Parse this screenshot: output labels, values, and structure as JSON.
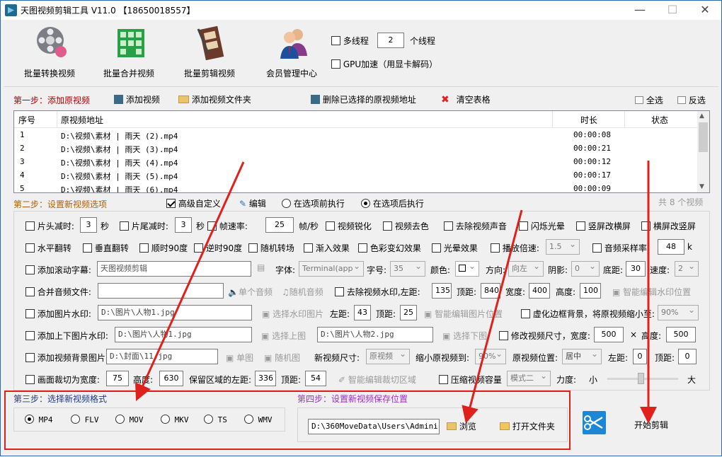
{
  "window": {
    "title": "天图视频剪辑工具 V11.0 【18650018557】"
  },
  "toolbar": {
    "batch_convert": "批量转换视频",
    "batch_merge": "批量合并视频",
    "batch_edit": "批量剪辑视频",
    "member": "会员管理中心",
    "multithread_label": "多线程",
    "thread_count": "2",
    "thread_unit": "个线程",
    "gpu_label": "GPU加速（用显卡解码）"
  },
  "step1": {
    "title": "第一步：添加原视频",
    "add_video": "添加视频",
    "add_folder": "添加视频文件夹",
    "delete_selected": "删除已选择的原视频地址",
    "clear_table": "清空表格",
    "select_all": "全选",
    "invert": "反选"
  },
  "table": {
    "headers": [
      "序号",
      "原视频地址",
      "时长",
      "状态"
    ],
    "rows": [
      {
        "no": "1",
        "path": "D:\\视频\\素材 | 雨天 (2).mp4",
        "duration": "00:00:08"
      },
      {
        "no": "2",
        "path": "D:\\视频\\素材 | 雨天 (3).mp4",
        "duration": "00:00:21"
      },
      {
        "no": "3",
        "path": "D:\\视频\\素材 | 雨天 (4).mp4",
        "duration": "00:00:12"
      },
      {
        "no": "4",
        "path": "D:\\视频\\素材 | 雨天 (5).mp4",
        "duration": "00:00:17"
      },
      {
        "no": "5",
        "path": "D:\\视频\\素材 | 雨天 (6).mp4",
        "duration": "00:00:09"
      }
    ],
    "count": "共 8 个视频"
  },
  "step2": {
    "title": "第二步：设置新视频选项",
    "advanced": "高级自定义",
    "edit": "编辑",
    "before": "在选项前执行",
    "after": "在选项后执行",
    "r1": {
      "head_cut": "片头减时:",
      "head_val": "3",
      "sec1": "秒",
      "tail_cut": "片尾减时:",
      "tail_val": "3",
      "sec2": "秒",
      "fps_cut": "帧速率:",
      "fps_val": "25",
      "fps_unit": "帧/秒",
      "sharpen": "视频锐化",
      "decolor": "视频去色",
      "remove_audio": "去除视频声音",
      "flash": "闪烁光晕",
      "v2h": "竖屏改横屏",
      "h2v": "横屏改竖屏"
    },
    "r2": {
      "hflip": "水平翻转",
      "vflip": "垂直翻转",
      "rot90cw": "顺时90度",
      "rot90ccw": "逆时90度",
      "random_trans": "随机转场",
      "fadein": "渐入效果",
      "color_fx": "色彩变幻效果",
      "halo": "光晕效果",
      "speed": "播放倍速:",
      "speed_val": "1.5",
      "sample": "音频采样率",
      "sample_val": "48",
      "sample_unit": "k"
    },
    "r3": {
      "scroll_sub": "添加滚动字幕:",
      "sub_text": "天图视频剪辑",
      "font_label": "字体:",
      "font_val": "Terminal(app",
      "size_label": "字号:",
      "size_val": "35",
      "color_label": "颜色:",
      "dir_label": "方向:",
      "dir_val": "向左",
      "shadow_label": "阴影:",
      "shadow_val": "0",
      "bottom_label": "底距:",
      "bottom_val": "30",
      "speed_label": "速度:",
      "speed_val": "2"
    },
    "r4": {
      "merge_audio": "合并音频文件:",
      "single_audio": "单个音频",
      "random_audio": "随机音频",
      "remove_wm": "去除视频水印,左距:",
      "left_val": "135",
      "top_label": "顶距:",
      "top_val": "840",
      "w_label": "宽度:",
      "w_val": "400",
      "h_label": "高度:",
      "h_val": "100",
      "smart_wm": "智能编辑水印位置"
    },
    "r5": {
      "img_wm": "添加图片水印:",
      "img_path": "D:\\图片\\人物1.jpg",
      "choose_wm": "选择水印图片",
      "left_label": "左距:",
      "left_val": "43",
      "top_label": "顶距:",
      "top_val": "25",
      "smart_img": "智能编辑图片位置",
      "blur_bg": "虚化边框背景，将原视频缩小至:",
      "blur_val": "90%"
    },
    "r6": {
      "tb_img": "添加上下图片水印:",
      "top_img": "D:\\图片\\人物1.jpg",
      "choose_top": "选择上图",
      "bottom_img": "D:\\图片\\人物2.jpg",
      "choose_bottom": "选择下图",
      "resize": "修改视频尺寸，宽度:",
      "w_val": "500",
      "x": "×",
      "h_label": "高度:",
      "h_val": "500"
    },
    "r7": {
      "bg_img": "添加视频背景图片:",
      "bg_path": "D:\\封面\\11.jpg",
      "single_img": "单图",
      "random_img": "随机图",
      "new_size": "新视频尺寸:",
      "size_val": "原视频",
      "shrink": "缩小原视频到:",
      "shrink_val": "90%",
      "pos_label": "原视频位置:",
      "pos_val": "居中",
      "left_label": "左距:",
      "left_val": "0",
      "top_label": "顶距:",
      "top_val": "0"
    },
    "r8": {
      "crop": "画面裁切为宽度:",
      "crop_w": "75",
      "h_label": "高度:",
      "crop_h": "630",
      "keep_left": "保留区域的左距:",
      "left_val": "336",
      "top_label": "顶距:",
      "top_val": "54",
      "smart_crop": "智能编辑裁切区域",
      "compress": "压缩视频容量",
      "mode_val": "模式二",
      "strength": "力度:",
      "small": "小",
      "big": "大"
    }
  },
  "step3": {
    "title": "第三步：选择新视频格式",
    "formats": [
      "MP4",
      "FLV",
      "MOV",
      "MKV",
      "TS",
      "WMV"
    ]
  },
  "step4": {
    "title": "第四步：设置新视频保存位置",
    "path": "D:\\360MoveData\\Users\\Administr",
    "browse": "浏览",
    "open_folder": "打开文件夹"
  },
  "start": {
    "label": "开始剪辑"
  }
}
